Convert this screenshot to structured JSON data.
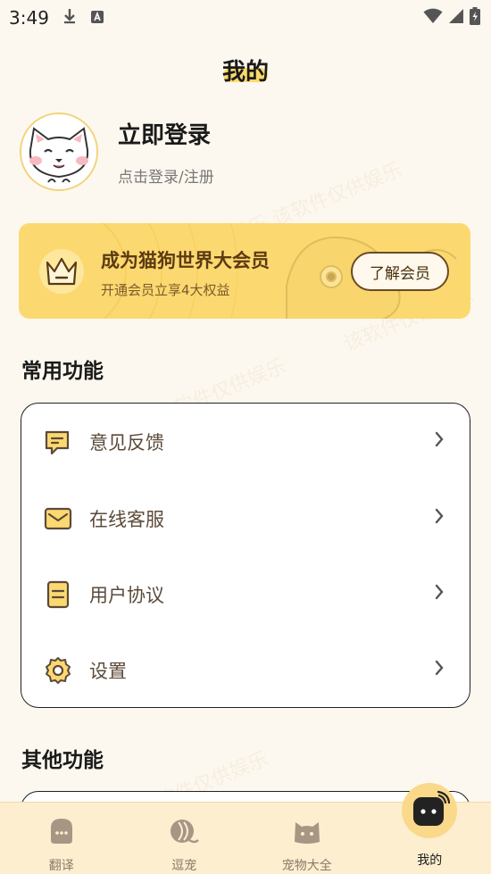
{
  "status": {
    "time": "3:49"
  },
  "page": {
    "title": "我的"
  },
  "profile": {
    "title": "立即登录",
    "subtitle": "点击登录/注册"
  },
  "vip": {
    "title": "成为猫狗世界大会员",
    "subtitle": "开通会员立享4大权益",
    "button": "了解会员"
  },
  "sections": {
    "common": "常用功能",
    "other": "其他功能"
  },
  "menu": {
    "items": [
      {
        "label": "意见反馈",
        "icon": "feedback-icon"
      },
      {
        "label": "在线客服",
        "icon": "mail-icon"
      },
      {
        "label": "用户协议",
        "icon": "document-icon"
      },
      {
        "label": "设置",
        "icon": "gear-icon"
      }
    ]
  },
  "tabs": [
    {
      "label": "翻译",
      "icon": "translate-icon"
    },
    {
      "label": "逗宠",
      "icon": "tease-pet-icon"
    },
    {
      "label": "宠物大全",
      "icon": "pet-encyclopedia-icon"
    },
    {
      "label": "我的",
      "icon": "profile-icon",
      "active": true
    }
  ],
  "watermark": "该软件仅供娱乐",
  "colors": {
    "accent": "#fcd970",
    "background": "#fdf8ef",
    "tab_bar": "#fdeed0"
  }
}
